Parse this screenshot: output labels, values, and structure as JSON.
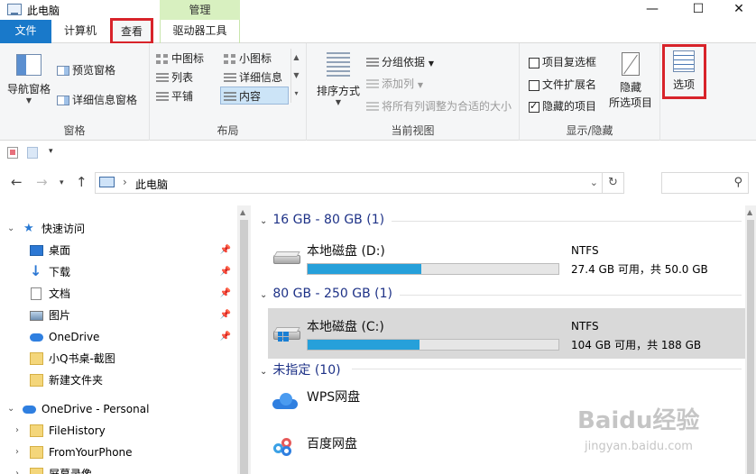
{
  "window": {
    "title": "此电脑",
    "minimize_label": "—",
    "maximize_label": "☐",
    "close_label": "✕"
  },
  "ribbon_tabs": {
    "manage_context": "管理",
    "file": "文件",
    "computer": "计算机",
    "view": "查看",
    "drive_tools": "驱动器工具",
    "help_label": "?",
    "collapse_label": "⌃"
  },
  "ribbon": {
    "panes_group": {
      "label": "窗格",
      "nav_pane": "导航窗格",
      "preview_pane": "预览窗格",
      "details_pane": "详细信息窗格"
    },
    "layout_group": {
      "label": "布局",
      "medium_icons": "中图标",
      "small_icons": "小图标",
      "list": "列表",
      "details": "详细信息",
      "tiles": "平铺",
      "content": "内容"
    },
    "current_view_group": {
      "label": "当前视图",
      "sort_by": "排序方式",
      "group_by": "分组依据",
      "add_columns": "添加列",
      "size_columns": "将所有列调整为合适的大小"
    },
    "show_hide_group": {
      "label": "显示/隐藏",
      "item_checkboxes": "项目复选框",
      "file_extensions": "文件扩展名",
      "hidden_items": "隐藏的项目",
      "hide_selected_line1": "隐藏",
      "hide_selected_line2": "所选项目",
      "item_checkboxes_checked": false,
      "file_extensions_checked": false,
      "hidden_items_checked": true
    },
    "options": "选项"
  },
  "address_bar": {
    "path": "此电脑",
    "separator": "›"
  },
  "nav_pane": {
    "quick_access": "快速访问",
    "items": [
      {
        "label": "桌面",
        "pinned": true
      },
      {
        "label": "下载",
        "pinned": true
      },
      {
        "label": "文档",
        "pinned": true
      },
      {
        "label": "图片",
        "pinned": true
      },
      {
        "label": "OneDrive",
        "pinned": true
      },
      {
        "label": "小Q书桌-截图",
        "pinned": false
      },
      {
        "label": "新建文件夹",
        "pinned": false
      }
    ],
    "onedrive_personal": "OneDrive - Personal",
    "onedrive_children": [
      "FileHistory",
      "FromYourPhone",
      "屏幕录像"
    ]
  },
  "content": {
    "groups": [
      {
        "header": "16 GB - 80 GB (1)",
        "drives": [
          {
            "name": "本地磁盘 (D:)",
            "fs": "NTFS",
            "free_text": "27.4 GB 可用，共 50.0 GB",
            "used_fraction": 0.452
          }
        ]
      },
      {
        "header": "80 GB - 250 GB (1)",
        "drives": [
          {
            "name": "本地磁盘 (C:)",
            "fs": "NTFS",
            "free_text": "104 GB 可用，共 188 GB",
            "used_fraction": 0.447
          }
        ]
      },
      {
        "header": "未指定 (10)",
        "items": [
          "WPS网盘",
          "百度网盘"
        ]
      }
    ]
  },
  "watermark": {
    "brand": "Baidu经验",
    "url": "jingyan.baidu.com"
  }
}
